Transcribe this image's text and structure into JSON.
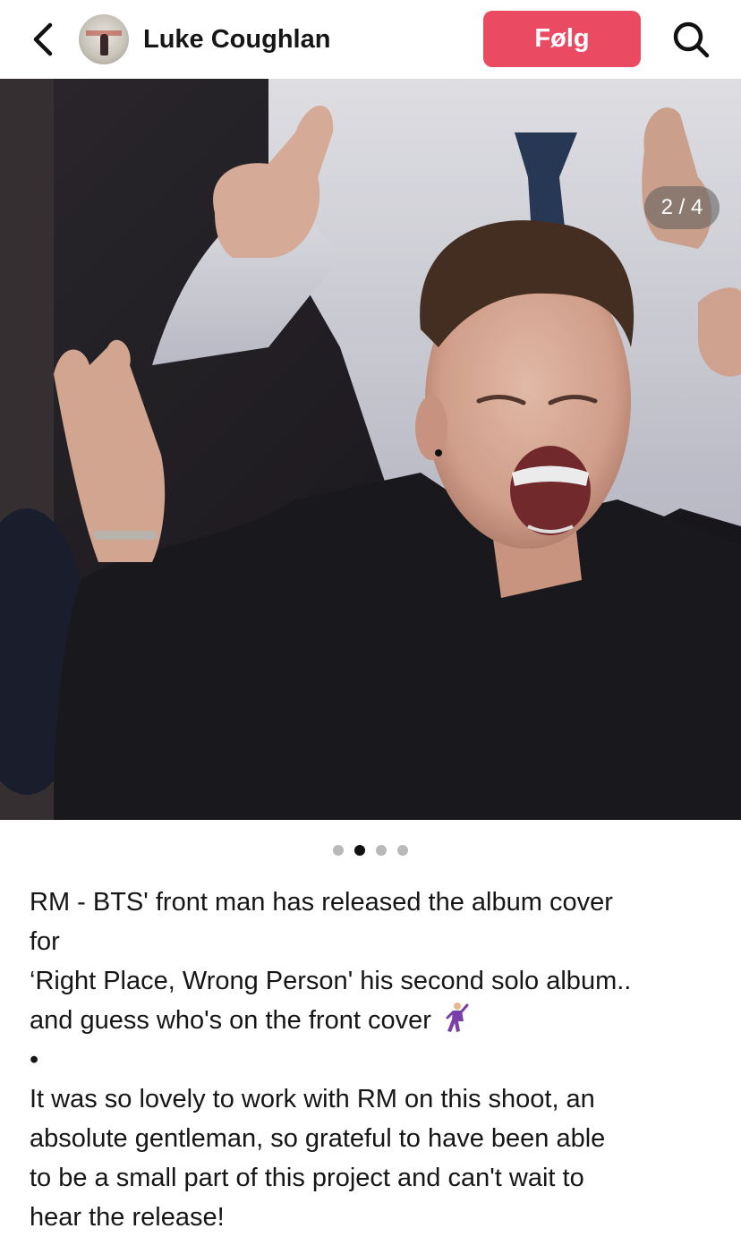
{
  "header": {
    "back_icon": "chevron-left-icon",
    "username": "Luke Coughlan",
    "follow_label": "Følg",
    "search_icon": "search-icon",
    "accent_color": "#ea4b63"
  },
  "media": {
    "counter": "2 / 4",
    "current_index": 2,
    "total": 4,
    "sound_icon": "speaker-on-icon"
  },
  "caption": {
    "line1": "RM - BTS' front man has released the album cover",
    "line2": "for",
    "line3": "‘Right Place, Wrong Person' his second solo album..",
    "line4": "and guess who's on the front cover",
    "line4_emoji": "dancing-man-emoji",
    "bullet": "•",
    "line5": "It was so lovely to work with RM on this shoot, an",
    "line6": "absolute gentleman, so grateful to have been able",
    "line7": "to be a small part of this project and can't wait to",
    "line8": "hear the release!"
  }
}
